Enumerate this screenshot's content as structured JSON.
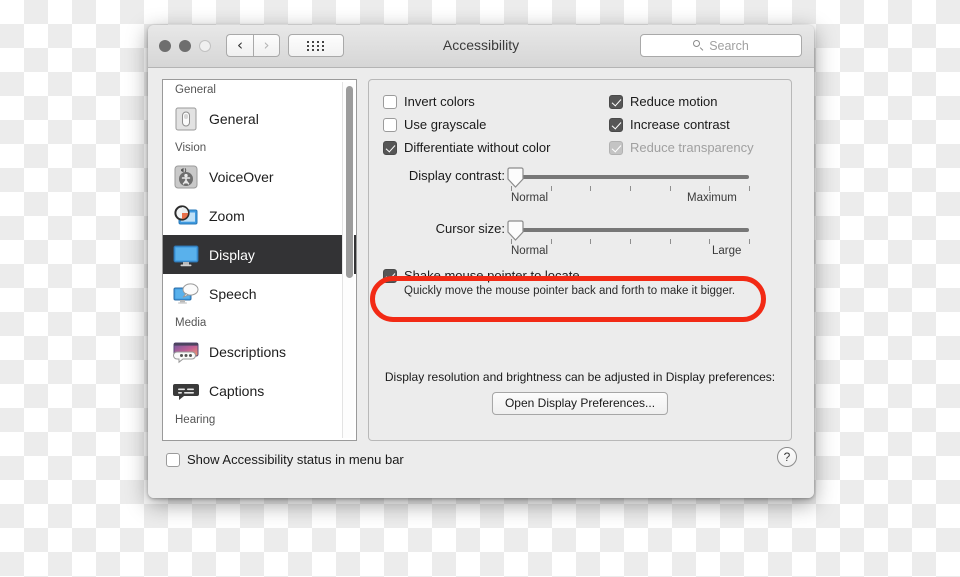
{
  "window": {
    "title": "Accessibility",
    "traffic_lights": [
      "close",
      "minimize",
      "zoom"
    ],
    "nav": {
      "back_icon": "chevron-left-icon",
      "forward_icon": "chevron-right-icon",
      "grid_icon": "show-all-grid-icon"
    },
    "search": {
      "placeholder": "Search",
      "value": "",
      "icon": "search-icon"
    }
  },
  "sidebar": {
    "groups": [
      {
        "header": "General",
        "items": [
          {
            "label": "General",
            "icon": "general-switch-icon",
            "selected": false
          }
        ]
      },
      {
        "header": "Vision",
        "items": [
          {
            "label": "VoiceOver",
            "icon": "voiceover-icon",
            "selected": false
          },
          {
            "label": "Zoom",
            "icon": "zoom-magnifier-icon",
            "selected": false
          },
          {
            "label": "Display",
            "icon": "display-monitor-icon",
            "selected": true
          },
          {
            "label": "Speech",
            "icon": "speech-bubble-monitor-icon",
            "selected": false
          }
        ]
      },
      {
        "header": "Media",
        "items": [
          {
            "label": "Descriptions",
            "icon": "descriptions-icon",
            "selected": false
          },
          {
            "label": "Captions",
            "icon": "captions-icon",
            "selected": false
          }
        ]
      },
      {
        "header": "Hearing",
        "items": []
      }
    ],
    "scrollbar": {
      "visible": true
    }
  },
  "panel": {
    "checkboxes_left": [
      {
        "label": "Invert colors",
        "checked": false,
        "enabled": true
      },
      {
        "label": "Use grayscale",
        "checked": false,
        "enabled": true
      },
      {
        "label": "Differentiate without color",
        "checked": true,
        "enabled": true
      }
    ],
    "checkboxes_right": [
      {
        "label": "Reduce motion",
        "checked": true,
        "enabled": true
      },
      {
        "label": "Increase contrast",
        "checked": true,
        "enabled": true
      },
      {
        "label": "Reduce transparency",
        "checked": true,
        "enabled": false
      }
    ],
    "sliders": [
      {
        "label": "Display contrast:",
        "min_label": "Normal",
        "max_label": "Maximum",
        "value_percent": 0,
        "tick_count": 7
      },
      {
        "label": "Cursor size:",
        "min_label": "Normal",
        "max_label": "Large",
        "value_percent": 0,
        "tick_count": 7
      }
    ],
    "shake": {
      "label": "Shake mouse pointer to locate",
      "description": "Quickly move the mouse pointer back and forth to make it bigger.",
      "checked": true
    },
    "note": "Display resolution and brightness can be adjusted in Display preferences:",
    "open_display_button": "Open Display Preferences..."
  },
  "bottom": {
    "status_checkbox": {
      "label": "Show Accessibility status in menu bar",
      "checked": false
    },
    "help_button": "?"
  },
  "annotation": {
    "shape": "oval",
    "color": "#f22a15",
    "target": "Shake mouse pointer to locate"
  }
}
